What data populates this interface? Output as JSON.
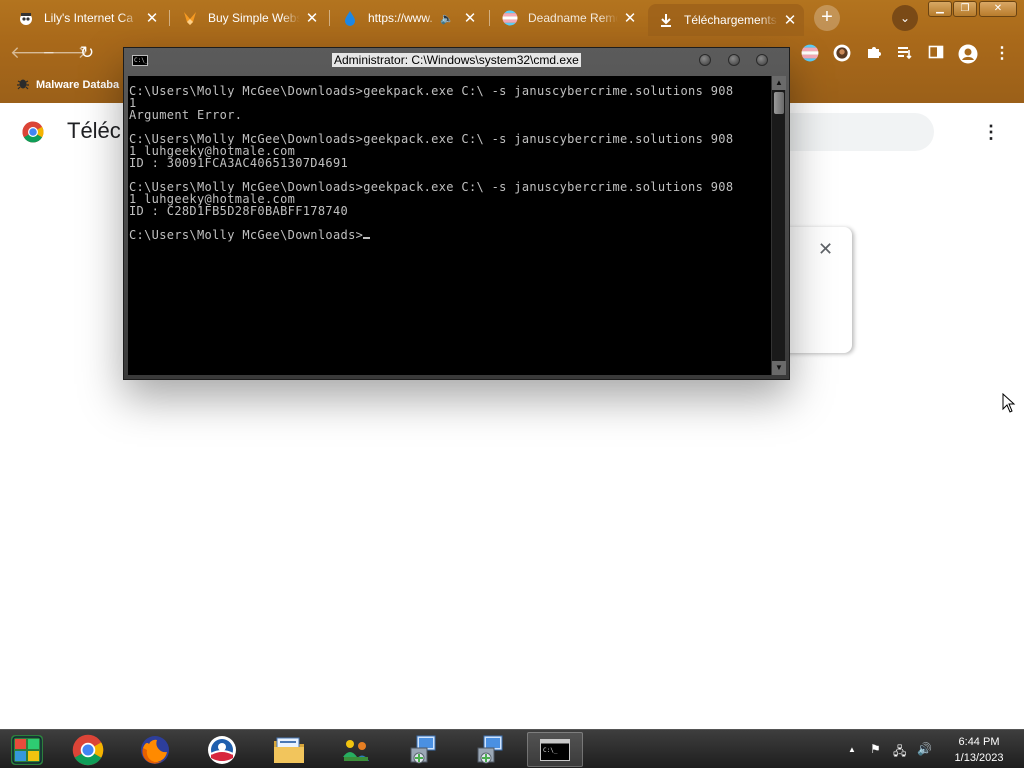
{
  "browser": {
    "tabs": [
      {
        "title": "Lily's Internet Ca",
        "icon": "spy-icon",
        "close": "✕"
      },
      {
        "title": "Buy Simple Websi",
        "icon": "fox-icon",
        "close": "✕"
      },
      {
        "title": "https://www.",
        "icon": "drop-icon",
        "audio": "🔈",
        "close": "✕"
      },
      {
        "title": "Deadname Remove",
        "icon": "trans-flag-icon",
        "close": "✕"
      },
      {
        "title": "Téléchargements",
        "icon": "download-icon",
        "close": "✕"
      }
    ],
    "new_tab": "+",
    "tab_search": "⌄",
    "bookmarks": [
      {
        "label": "Malware Databa"
      }
    ],
    "accent": "#a86a1c"
  },
  "page": {
    "title": "Téléc",
    "menu_icon": "⋮",
    "card_close": "✕"
  },
  "cmd": {
    "title": "Administrator: C:\\Windows\\system32\\cmd.exe",
    "sysicon": "C:\\_",
    "lines": [
      "C:\\Users\\Molly McGee\\Downloads>geekpack.exe C:\\ -s januscybercrime.solutions 908",
      "1",
      "Argument Error.",
      "",
      "C:\\Users\\Molly McGee\\Downloads>geekpack.exe C:\\ -s januscybercrime.solutions 908",
      "1 luhgeeky@hotmale.com",
      "ID : 30091FCA3AC40651307D4691",
      "",
      "C:\\Users\\Molly McGee\\Downloads>geekpack.exe C:\\ -s januscybercrime.solutions 908",
      "1 luhgeeky@hotmale.com",
      "ID : C28D1FB5D28F0BABFF178740",
      ""
    ],
    "prompt": "C:\\Users\\Molly McGee\\Downloads>"
  },
  "taskbar": {
    "items": [
      {
        "name": "start-button",
        "icon": "windows-orb-icon"
      },
      {
        "name": "taskbar-chrome",
        "icon": "chrome-icon"
      },
      {
        "name": "taskbar-firefox",
        "icon": "firefox-icon"
      },
      {
        "name": "taskbar-obama",
        "icon": "campaign-logo-icon"
      },
      {
        "name": "taskbar-explorer",
        "icon": "folder-icon"
      },
      {
        "name": "taskbar-network",
        "icon": "network-people-icon"
      },
      {
        "name": "taskbar-installer-1",
        "icon": "installer-icon"
      },
      {
        "name": "taskbar-installer-2",
        "icon": "installer-icon"
      },
      {
        "name": "taskbar-cmd",
        "icon": "cmd-icon"
      }
    ],
    "tray": {
      "chevron": "▲",
      "flag": "⚑",
      "network": "🖧",
      "volume": "🔊"
    },
    "clock": {
      "time": "6:44 PM",
      "date": "1/13/2023"
    }
  }
}
